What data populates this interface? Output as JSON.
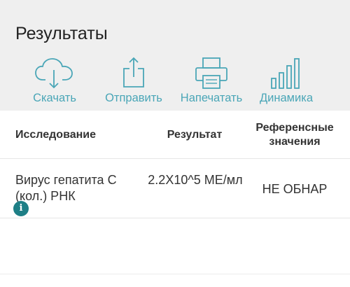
{
  "header": {
    "title": "Результаты"
  },
  "toolbar": {
    "download": {
      "label": "Скачать",
      "icon": "cloud-download-icon"
    },
    "send": {
      "label": "Отправить",
      "icon": "share-icon"
    },
    "print": {
      "label": "Напечатать",
      "icon": "printer-icon"
    },
    "dynamics": {
      "label": "Динамика",
      "icon": "bar-chart-icon"
    },
    "accent_color": "#4aa6b7"
  },
  "table": {
    "columns": {
      "study": "Исследование",
      "result": "Результат",
      "reference_line1": "Референсные",
      "reference_line2": "значения"
    },
    "rows": [
      {
        "study": "Вирус гепатита С (кол.) РНК",
        "result": "2.2X10^5 МЕ/мл",
        "reference": "НЕ ОБНАР",
        "info_glyph": "i"
      }
    ]
  }
}
